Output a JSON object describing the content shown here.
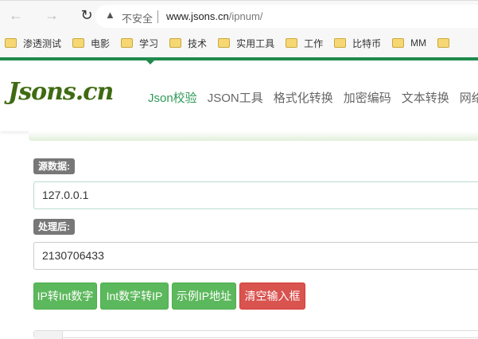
{
  "browser": {
    "back_icon": "arrow-left",
    "forward_icon": "arrow-right",
    "reload_icon": "reload",
    "security_icon": "warning-triangle",
    "security_text": "不安全",
    "url_host": "www.jsons.cn",
    "url_path": "/ipnum/"
  },
  "bookmarks": [
    "渗透测试",
    "电影",
    "学习",
    "技术",
    "实用工具",
    "工作",
    "比特币",
    "MM",
    ""
  ],
  "header": {
    "logo": "Jsons.cn",
    "menu": [
      "Json校验",
      "JSON工具",
      "格式化转换",
      "加密编码",
      "文本转换",
      "网络"
    ],
    "brand_color": "#1f8a4c"
  },
  "form": {
    "source_label": "源数据:",
    "source_value": "127.0.0.1",
    "result_label": "处理后:",
    "result_value": "2130706433",
    "buttons": [
      "IP转Int数字",
      "Int数字转IP",
      "示例IP地址",
      "清空输入框"
    ]
  }
}
